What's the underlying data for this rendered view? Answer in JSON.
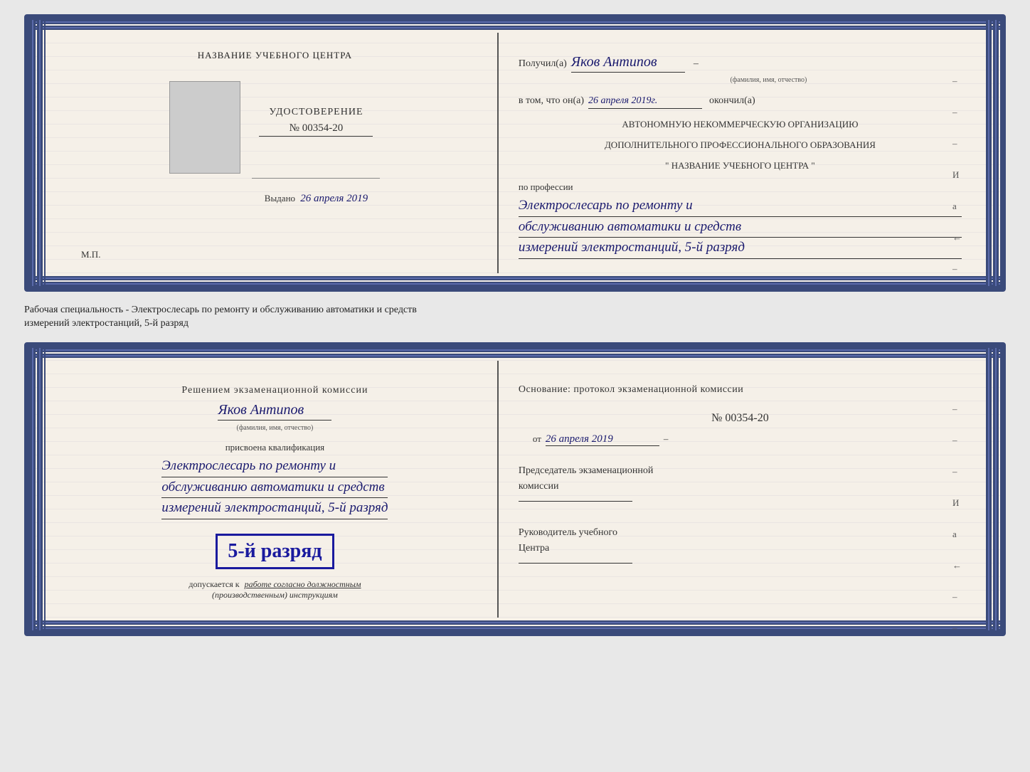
{
  "card1": {
    "left": {
      "center_title": "НАЗВАНИЕ УЧЕБНОГО ЦЕНТРА",
      "cert_label": "УДОСТОВЕРЕНИЕ",
      "cert_number": "№ 00354-20",
      "issued_label": "Выдано",
      "issued_date": "26 апреля 2019",
      "mp_label": "М.П."
    },
    "right": {
      "received_prefix": "Получил(а)",
      "recipient_name": "Яков Антипов",
      "recipient_label": "(фамилия, имя, отчество)",
      "in_that_prefix": "в том, что он(а)",
      "completion_date": "26 апреля 2019г.",
      "finished_label": "окончил(а)",
      "org_line1": "АВТОНОМНУЮ НЕКОММЕРЧЕСКУЮ ОРГАНИЗАЦИЮ",
      "org_line2": "ДОПОЛНИТЕЛЬНОГО ПРОФЕССИОНАЛЬНОГО ОБРАЗОВАНИЯ",
      "org_name": "\" НАЗВАНИЕ УЧЕБНОГО ЦЕНТРА \"",
      "profession_label": "по профессии",
      "profession_line1": "Электрослесарь по ремонту и",
      "profession_line2": "обслуживанию автоматики и средств",
      "profession_line3": "измерений электростанций, 5-й разряд",
      "side_marks": [
        "–",
        "–",
        "–",
        "И",
        "а",
        "←",
        "–",
        "–",
        "–"
      ]
    }
  },
  "specialty_label": "Рабочая специальность - Электрослесарь по ремонту и обслуживанию автоматики и средств\nизмерений электростанций, 5-й разряд",
  "card2": {
    "left": {
      "decision_line": "Решением экзаменационной комиссии",
      "name": "Яков Антипов",
      "name_label": "(фамилия, имя, отчество)",
      "assigned_label": "присвоена квалификация",
      "qual_line1": "Электрослесарь по ремонту и",
      "qual_line2": "обслуживанию автоматики и средств",
      "qual_line3": "измерений электростанций, 5-й разряд",
      "grade_text": "5-й разряд",
      "allowed_prefix": "допускается к",
      "allowed_text": "работе согласно должностным",
      "allowed_text2": "(производственным) инструкциям"
    },
    "right": {
      "basis_label": "Основание: протокол экзаменационной комиссии",
      "protocol_number": "№ 00354-20",
      "date_prefix": "от",
      "date": "26 апреля 2019",
      "chairman_label": "Председатель экзаменационной",
      "chairman_label2": "комиссии",
      "director_label": "Руководитель учебного",
      "director_label2": "Центра",
      "side_marks": [
        "–",
        "–",
        "–",
        "И",
        "а",
        "←",
        "–",
        "–",
        "–"
      ]
    }
  }
}
